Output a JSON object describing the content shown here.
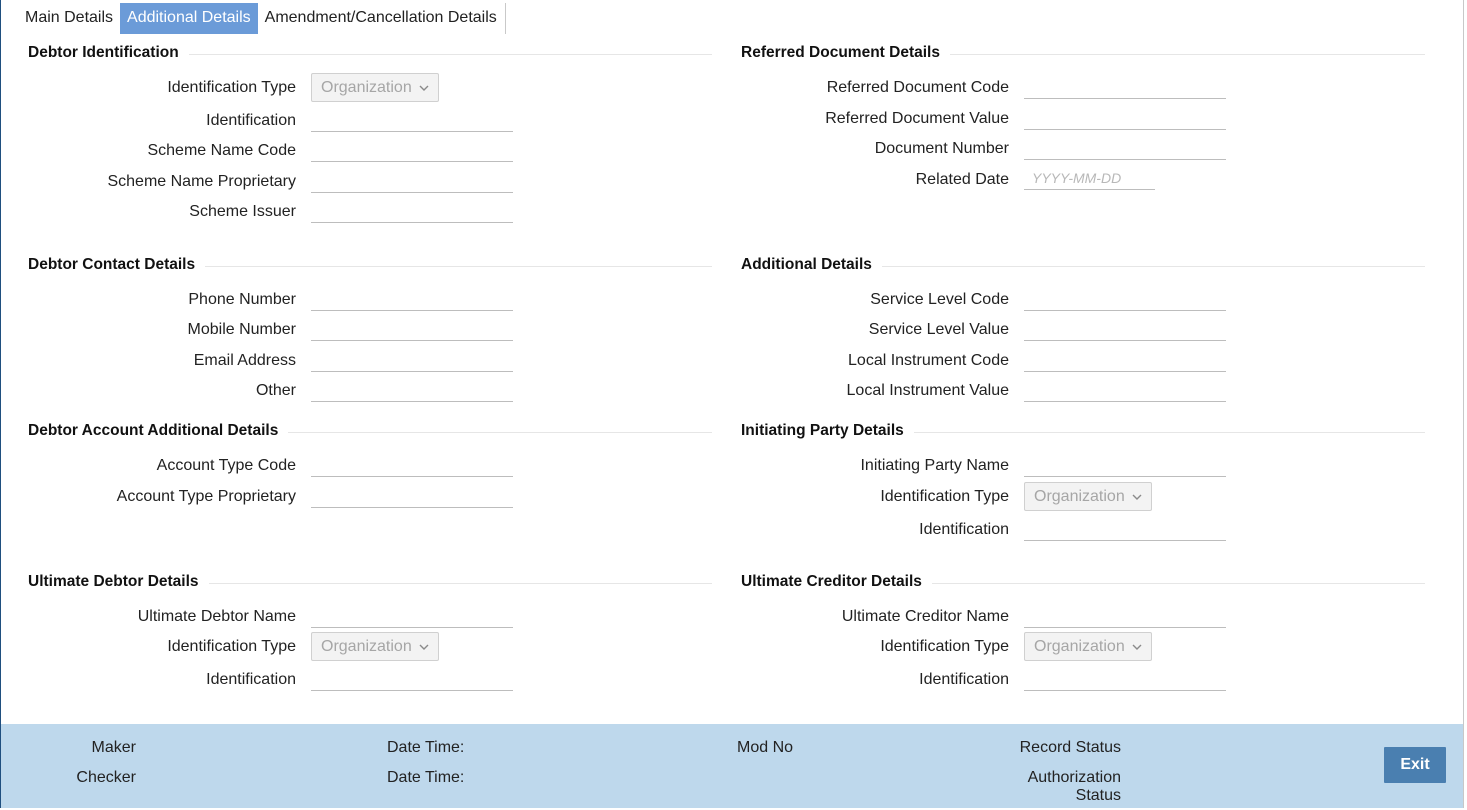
{
  "tabs": [
    {
      "label": "Main Details"
    },
    {
      "label": "Additional Details"
    },
    {
      "label": "Amendment/Cancellation Details"
    }
  ],
  "debtor_identification": {
    "title": "Debtor Identification",
    "identification_type_label": "Identification Type",
    "identification_type_value": "Organization",
    "identification_label": "Identification",
    "scheme_name_code_label": "Scheme Name Code",
    "scheme_name_proprietary_label": "Scheme Name Proprietary",
    "scheme_issuer_label": "Scheme Issuer"
  },
  "referred_document": {
    "title": "Referred Document Details",
    "code_label": "Referred Document Code",
    "value_label": "Referred Document Value",
    "document_number_label": "Document Number",
    "related_date_label": "Related Date",
    "related_date_placeholder": "YYYY-MM-DD"
  },
  "debtor_contact": {
    "title": "Debtor Contact Details",
    "phone_label": "Phone Number",
    "mobile_label": "Mobile Number",
    "email_label": "Email Address",
    "other_label": "Other"
  },
  "additional_details": {
    "title": "Additional Details",
    "service_level_code_label": "Service Level Code",
    "service_level_value_label": "Service Level Value",
    "local_instrument_code_label": "Local Instrument Code",
    "local_instrument_value_label": "Local Instrument Value"
  },
  "debtor_account": {
    "title": "Debtor Account Additional Details",
    "account_type_code_label": "Account Type Code",
    "account_type_proprietary_label": "Account Type Proprietary"
  },
  "initiating_party": {
    "title": "Initiating Party Details",
    "name_label": "Initiating Party Name",
    "identification_type_label": "Identification Type",
    "identification_type_value": "Organization",
    "identification_label": "Identification"
  },
  "ultimate_debtor": {
    "title": "Ultimate Debtor Details",
    "name_label": "Ultimate Debtor Name",
    "identification_type_label": "Identification Type",
    "identification_type_value": "Organization",
    "identification_label": "Identification"
  },
  "ultimate_creditor": {
    "title": "Ultimate Creditor Details",
    "name_label": "Ultimate Creditor Name",
    "identification_type_label": "Identification Type",
    "identification_type_value": "Organization",
    "identification_label": "Identification"
  },
  "footer": {
    "maker_label": "Maker",
    "checker_label": "Checker",
    "date_time_label_1": "Date Time:",
    "date_time_label_2": "Date Time:",
    "mod_no_label": "Mod No",
    "record_status_label": "Record Status",
    "authorization_label": "Authorization",
    "status_label": "Status",
    "exit_label": "Exit"
  },
  "colors": {
    "active_tab": "#6b9bd8",
    "footer_bg": "#bed8ec",
    "exit_button": "#4a7fb0"
  }
}
